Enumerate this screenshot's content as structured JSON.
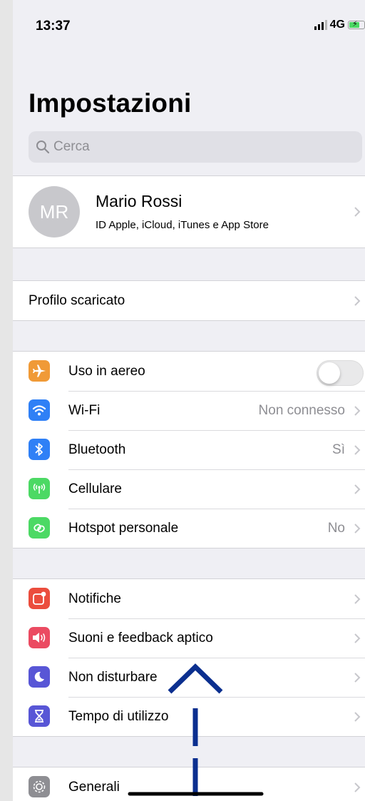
{
  "status": {
    "time": "13:37",
    "network": "4G"
  },
  "title": "Impostazioni",
  "search": {
    "placeholder": "Cerca"
  },
  "profile": {
    "initials": "MR",
    "name": "Mario Rossi",
    "subtitle": "ID Apple, iCloud, iTunes e App Store"
  },
  "downloaded_profile": {
    "label": "Profilo scaricato"
  },
  "connectivity": [
    {
      "label": "Uso in aereo",
      "icon": "airplane-icon",
      "color": "#f09a37",
      "toggle": "off"
    },
    {
      "label": "Wi-Fi",
      "value": "Non connesso",
      "icon": "wifi-icon",
      "color": "#2f80f6"
    },
    {
      "label": "Bluetooth",
      "value": "Sì",
      "icon": "bluetooth-icon",
      "color": "#2f80f6"
    },
    {
      "label": "Cellulare",
      "icon": "cellular-icon",
      "color": "#4cd964"
    },
    {
      "label": "Hotspot personale",
      "value": "No",
      "icon": "hotspot-icon",
      "color": "#4cd964"
    }
  ],
  "notifications_group": [
    {
      "label": "Notifiche",
      "icon": "notifications-icon",
      "color": "#eb4d3d"
    },
    {
      "label": "Suoni e feedback aptico",
      "icon": "sounds-icon",
      "color": "#eb4b62"
    },
    {
      "label": "Non disturbare",
      "icon": "moon-icon",
      "color": "#5856d6"
    },
    {
      "label": "Tempo di utilizzo",
      "icon": "hourglass-icon",
      "color": "#5856d6"
    }
  ],
  "general": {
    "label": "Generali",
    "icon": "gear-icon",
    "color": "#8e8e93"
  }
}
